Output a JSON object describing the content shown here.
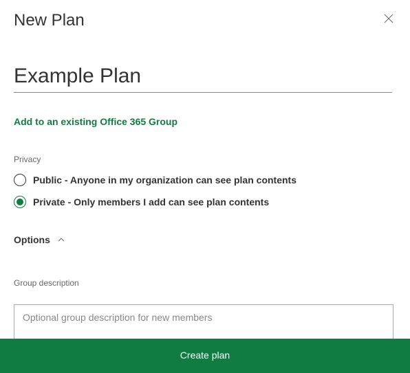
{
  "header": {
    "title": "New Plan"
  },
  "form": {
    "planName": "Example Plan",
    "addGroupLink": "Add to an existing Office 365 Group",
    "privacy": {
      "label": "Privacy",
      "options": {
        "public": "Public - Anyone in my organization can see plan contents",
        "private": "Private - Only members I add can see plan contents"
      },
      "selected": "private"
    },
    "optionsToggle": "Options",
    "groupDescription": {
      "label": "Group description",
      "placeholder": "Optional group description for new members",
      "value": ""
    }
  },
  "footer": {
    "createButton": "Create plan"
  },
  "colors": {
    "accent": "#107c41"
  }
}
